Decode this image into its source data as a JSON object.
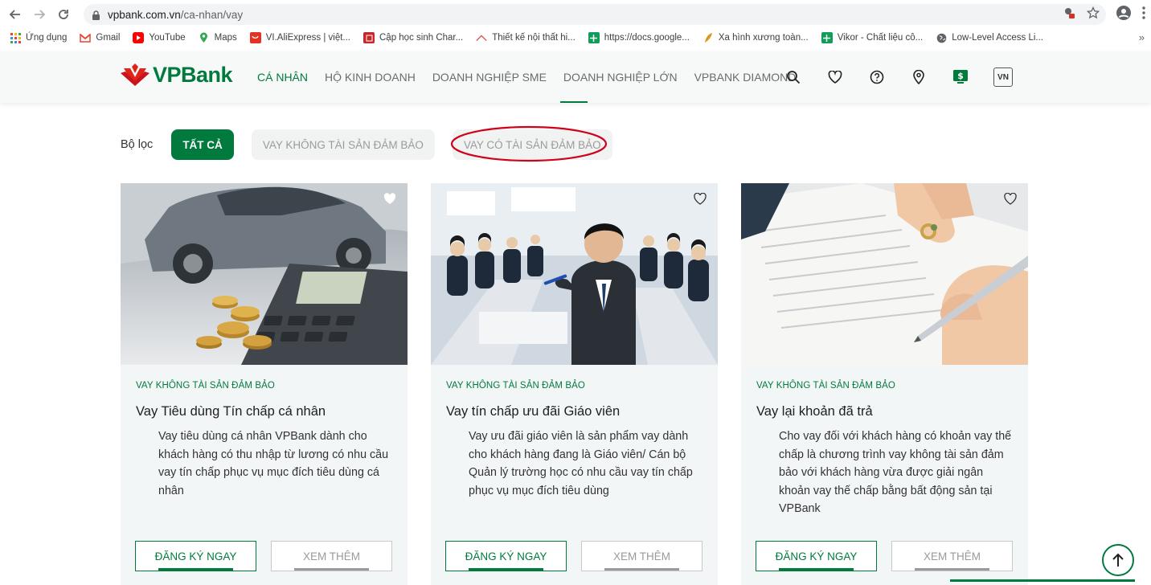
{
  "browser": {
    "url_host": "vpbank.com.vn",
    "url_path": "/ca-nhan/vay",
    "bookmarks": [
      {
        "label": "Ứng dụng",
        "icon": "apps-grid-icon"
      },
      {
        "label": "Gmail",
        "icon": "gmail-icon"
      },
      {
        "label": "YouTube",
        "icon": "youtube-icon"
      },
      {
        "label": "Maps",
        "icon": "maps-pin-icon"
      },
      {
        "label": "VI.AliExpress | việt...",
        "icon": "aliexpress-icon"
      },
      {
        "label": "Cập học sinh Char...",
        "icon": "site-icon"
      },
      {
        "label": "Thiết kế nội thất hi...",
        "icon": "interior-icon"
      },
      {
        "label": "https://docs.google...",
        "icon": "sheets-icon"
      },
      {
        "label": "Xa hình xương toàn...",
        "icon": "leaf-icon"
      },
      {
        "label": "Vikor - Chất liệu cô...",
        "icon": "sheets-icon"
      },
      {
        "label": "Low-Level Access Li...",
        "icon": "globe-icon"
      }
    ],
    "more": "»"
  },
  "header": {
    "logo_text": "VPBank",
    "nav": [
      {
        "label": "CÁ NHÂN",
        "active": true
      },
      {
        "label": "HỘ KINH DOANH",
        "active": false
      },
      {
        "label": "DOANH NGHIỆP SME",
        "active": false
      },
      {
        "label": "DOANH NGHIỆP LỚN",
        "active": false
      },
      {
        "label": "VPBANK DIAMOND",
        "active": false
      }
    ],
    "lang": "VN"
  },
  "filter": {
    "label": "Bộ lọc",
    "chips": [
      {
        "label": "TẤT CẢ",
        "active": true
      },
      {
        "label": "VAY KHÔNG TÀI SẢN ĐẢM BẢO",
        "active": false
      },
      {
        "label": "VAY CÓ TÀI SẢN ĐẢM BẢO",
        "active": false
      }
    ]
  },
  "cards": [
    {
      "category": "VAY KHÔNG TÀI SẢN ĐẢM BẢO",
      "title": "Vay Tiêu dùng Tín chấp cá nhân",
      "description": "Vay tiêu dùng cá nhân VPBank dành cho khách hàng có thu nhập từ lương có nhu cầu vay tín chấp phục vụ mục đích tiêu dùng cá nhân",
      "primary_btn": "ĐĂNG KÝ NGAY",
      "secondary_btn": "XEM THÊM"
    },
    {
      "category": "VAY KHÔNG TÀI SẢN ĐẢM BẢO",
      "title": "Vay tín chấp ưu đãi Giáo viên",
      "description": "Vay ưu đãi giáo viên là sản phẩm vay dành cho khách hàng đang là Giáo viên/ Cán bộ Quản lý trường học có nhu cầu vay tín chấp phục vụ mục đích tiêu dùng",
      "primary_btn": "ĐĂNG KÝ NGAY",
      "secondary_btn": "XEM THÊM"
    },
    {
      "category": "VAY KHÔNG TÀI SẢN ĐẢM BẢO",
      "title": "Vay lại khoản đã trả",
      "description": "Cho vay đối với khách hàng có khoản vay thế chấp là chương trình vay không tài sản đảm bảo với khách hàng vừa được giải ngân khoản vay thế chấp bằng bất động sản tại VPBank",
      "primary_btn": "ĐĂNG KÝ NGAY",
      "secondary_btn": "XEM THÊM"
    }
  ],
  "colors": {
    "brand_green": "#007a3d",
    "logo_red": "#e2231a",
    "annotation_red": "#d0021b"
  }
}
